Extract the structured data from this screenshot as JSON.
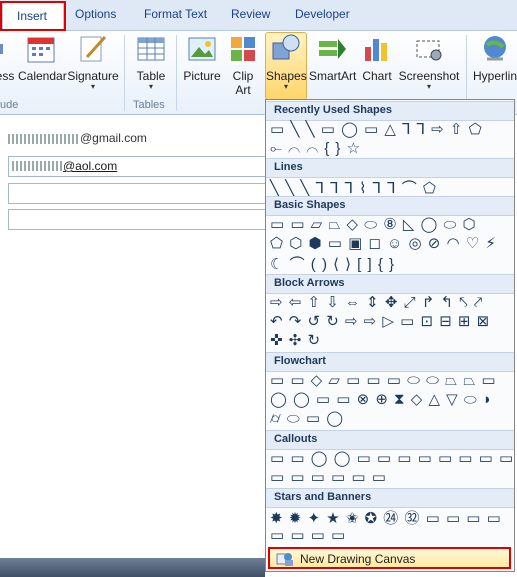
{
  "tabs": [
    "Insert",
    "Options",
    "Format Text",
    "Review",
    "Developer"
  ],
  "ribbon": {
    "buttons": [
      {
        "label": "ess",
        "sub": ""
      },
      {
        "label": "Calendar",
        "sub": ""
      },
      {
        "label": "Signature",
        "sub": "▾"
      },
      {
        "label": "Table",
        "sub": "▾"
      },
      {
        "label": "Picture",
        "sub": ""
      },
      {
        "label": "Clip",
        "sub": "Art"
      },
      {
        "label": "Shapes",
        "sub": "▾"
      },
      {
        "label": "SmartArt",
        "sub": ""
      },
      {
        "label": "Chart",
        "sub": ""
      },
      {
        "label": "Screenshot",
        "sub": "▾"
      },
      {
        "label": "Hyperlin",
        "sub": ""
      }
    ],
    "groups": [
      "ude",
      "Tables"
    ]
  },
  "email_form": {
    "from_value": "@gmail.com",
    "to_value": "@aol.com"
  },
  "menu": {
    "sections": [
      "Recently Used Shapes",
      "Lines",
      "Basic Shapes",
      "Block Arrows",
      "Flowchart",
      "Callouts",
      "Stars and Banners"
    ],
    "rows": [
      "▭ ╲ ╲ ▭ ◯ ▭ △ ⅂ ⅂ ⇨ ⇧ ⬠",
      "⟜ ⌒ ⌒ { } ☆",
      "╲ ╲ ╲ ⅂ ⅂ ⅂ ⌇ ⅂ ⅂ ⌒ ⬠",
      "▭ ▭ ▱ ⏢ ◇ ⬭ ⑧ ◺ ◯ ⬭ ⬡",
      "⬠ ⬡ ⬢ ▭ ▣ ◻ ☺ ◎ ⊘ ◠ ♡ ⚡",
      "☾ ⌒ ( ) ⟨ ⟩ [ ] { }",
      "⇨ ⇦ ⇧ ⇩ ⇔ ⇕ ✥ ⤢ ↱ ↰ ⤣ ⤤",
      "↶ ↷ ↺ ↻ ⇨ ⇨ ▷ ▭ ⊡ ⊟ ⊞ ⊠",
      "✜ ✣ ↻",
      "▭ ▭ ◇ ▱ ▭ ▭ ▭ ⬭ ⬭ ⏢ ⏢ ▭",
      "◯ ◯ ▭ ▭ ⊗ ⊕ ⧗ ◇ △ ▽ ⬭ ◗",
      "⌭ ⬭ ▭ ◯",
      "▭ ▭ ◯ ◯ ▭ ▭ ▭ ▭ ▭ ▭ ▭ ▭",
      "▭ ▭ ▭ ▭ ▭ ▭",
      "✸ ✹ ✦ ★ ✬ ✪ ㉔ ㉜ ▭ ▭ ▭ ▭",
      "▭ ▭ ▭ ▭"
    ],
    "bottom_item": "New Drawing Canvas"
  }
}
